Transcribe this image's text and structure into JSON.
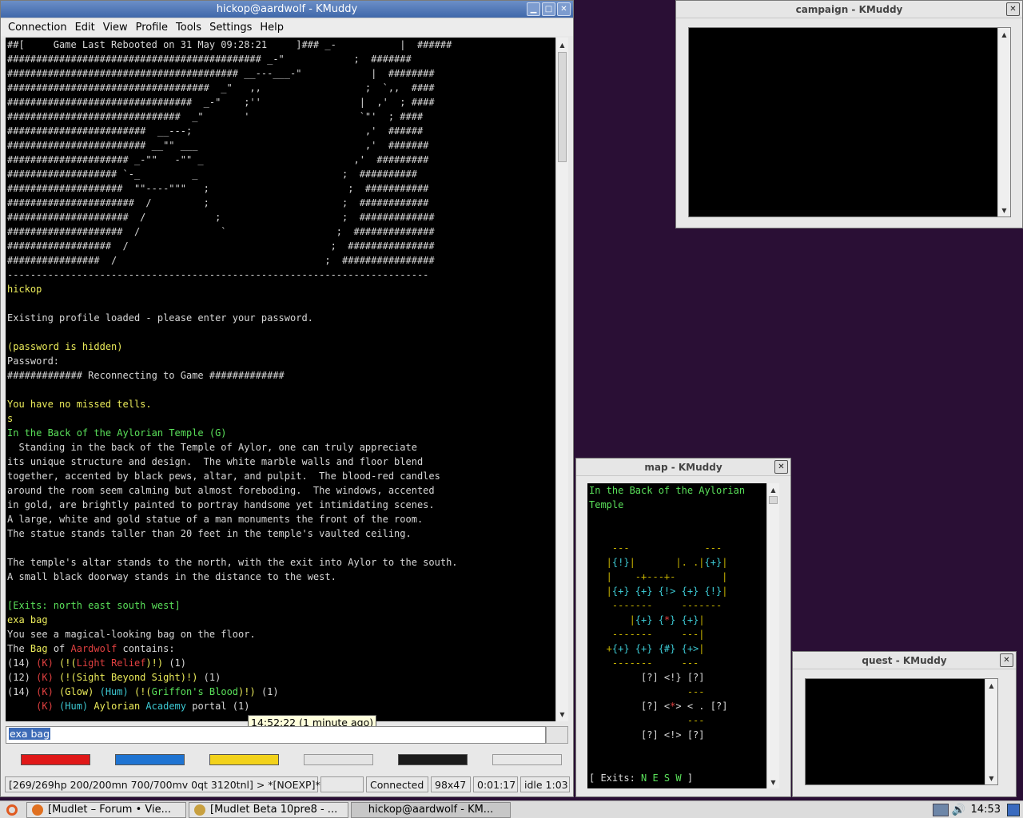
{
  "main_window": {
    "title": "hickop@aardwolf - KMuddy",
    "menu": [
      "Connection",
      "Edit",
      "View",
      "Profile",
      "Tools",
      "Settings",
      "Help"
    ],
    "terminal_lines": [
      [
        {
          "t": "##[     Game Last Rebooted on 31 May 09:28:21     ]### _-           |  ######",
          "c": "w"
        }
      ],
      [
        {
          "t": "############################################ _-\"            ;  #######",
          "c": "w"
        }
      ],
      [
        {
          "t": "######################################## __---___-\"            |  ########",
          "c": "w"
        }
      ],
      [
        {
          "t": "###################################  _\"   ,,                  ;  `,,  ####",
          "c": "w"
        }
      ],
      [
        {
          "t": "################################  _-\"    ;''                 |  ,'  ; ####",
          "c": "w"
        }
      ],
      [
        {
          "t": "##############################  _\"       '                   `\"'  ; ####",
          "c": "w"
        }
      ],
      [
        {
          "t": "########################  __---;                              ,'  ######",
          "c": "w"
        }
      ],
      [
        {
          "t": "######################## __\"\" ___                             ,'  #######",
          "c": "w"
        }
      ],
      [
        {
          "t": "##################### _-\"\"   -\"\" _                          ,'  #########",
          "c": "w"
        }
      ],
      [
        {
          "t": "################### `-_         _                         ;  ##########",
          "c": "w"
        }
      ],
      [
        {
          "t": "####################  \"\"----\"\"\"   ;                        ;  ###########",
          "c": "w"
        }
      ],
      [
        {
          "t": "######################  /         ;                       ;  ############",
          "c": "w"
        }
      ],
      [
        {
          "t": "#####################  /            ;                     ;  #############",
          "c": "w"
        }
      ],
      [
        {
          "t": "####################  /              `                   ;  ##############",
          "c": "w"
        }
      ],
      [
        {
          "t": "##################  /                                   ;  ###############",
          "c": "w"
        }
      ],
      [
        {
          "t": "################  /                                    ;  ################",
          "c": "w"
        }
      ],
      [
        {
          "t": "-------------------------------------------------------------------------",
          "c": "w"
        }
      ],
      [
        {
          "t": "hickop",
          "c": "y"
        }
      ],
      [
        {
          "t": "",
          "c": "w"
        }
      ],
      [
        {
          "t": "Existing profile loaded - please enter your password.",
          "c": "w"
        }
      ],
      [
        {
          "t": "",
          "c": "w"
        }
      ],
      [
        {
          "t": "(password is hidden)",
          "c": "y"
        }
      ],
      [
        {
          "t": "Password:",
          "c": "w"
        }
      ],
      [
        {
          "t": "############# Reconnecting to Game #############",
          "c": "w"
        }
      ],
      [
        {
          "t": "",
          "c": "w"
        }
      ],
      [
        {
          "t": "You have no missed tells.",
          "c": "y"
        }
      ],
      [
        {
          "t": "s",
          "c": "y"
        }
      ],
      [
        {
          "t": "In the Back of the Aylorian Temple (G)",
          "c": "g"
        }
      ],
      [
        {
          "t": "  Standing in the back of the Temple of Aylor, one can truly appreciate",
          "c": "w"
        }
      ],
      [
        {
          "t": "its unique structure and design.  The white marble walls and floor blend",
          "c": "w"
        }
      ],
      [
        {
          "t": "together, accented by black pews, altar, and pulpit.  The blood-red candles",
          "c": "w"
        }
      ],
      [
        {
          "t": "around the room seem calming but almost foreboding.  The windows, accented",
          "c": "w"
        }
      ],
      [
        {
          "t": "in gold, are brightly painted to portray handsome yet intimidating scenes.",
          "c": "w"
        }
      ],
      [
        {
          "t": "A large, white and gold statue of a man monuments the front of the room.",
          "c": "w"
        }
      ],
      [
        {
          "t": "The statue stands taller than 20 feet in the temple's vaulted ceiling.",
          "c": "w"
        }
      ],
      [
        {
          "t": "",
          "c": "w"
        }
      ],
      [
        {
          "t": "The temple's altar stands to the north, with the exit into Aylor to the south.",
          "c": "w"
        }
      ],
      [
        {
          "t": "A small black doorway stands in the distance to the west.",
          "c": "w"
        }
      ],
      [
        {
          "t": "",
          "c": "w"
        }
      ],
      [
        {
          "t": "[Exits: north east south west]",
          "c": "g"
        }
      ],
      [
        {
          "t": "exa bag",
          "c": "y"
        }
      ],
      [
        {
          "t": "You see a magical-looking bag on the floor.",
          "c": "w"
        }
      ],
      [
        {
          "t": "The ",
          "c": "w"
        },
        {
          "t": "Bag",
          "c": "y"
        },
        {
          "t": " of ",
          "c": "w"
        },
        {
          "t": "Aardwolf",
          "c": "r"
        },
        {
          "t": " contains:",
          "c": "w"
        }
      ],
      [
        {
          "t": "(14) ",
          "c": "w"
        },
        {
          "t": "(K) ",
          "c": "r"
        },
        {
          "t": "(!(",
          "c": "y"
        },
        {
          "t": "Light Relief",
          "c": "r"
        },
        {
          "t": ")!) ",
          "c": "y"
        },
        {
          "t": "(1)",
          "c": "w"
        }
      ],
      [
        {
          "t": "(12) ",
          "c": "w"
        },
        {
          "t": "(K) ",
          "c": "r"
        },
        {
          "t": "(!(Sight Beyond Sight)!) ",
          "c": "y"
        },
        {
          "t": "(1)",
          "c": "w"
        }
      ],
      [
        {
          "t": "(14) ",
          "c": "w"
        },
        {
          "t": "(K) ",
          "c": "r"
        },
        {
          "t": "(Glow) ",
          "c": "y"
        },
        {
          "t": "(Hum) ",
          "c": "c"
        },
        {
          "t": "(!(",
          "c": "y"
        },
        {
          "t": "Griffon's Blood",
          "c": "g"
        },
        {
          "t": ")!) ",
          "c": "y"
        },
        {
          "t": "(1)",
          "c": "w"
        }
      ],
      [
        {
          "t": "     ",
          "c": "w"
        },
        {
          "t": "(K) ",
          "c": "r"
        },
        {
          "t": "(Hum) ",
          "c": "c"
        },
        {
          "t": "Aylorian ",
          "c": "y"
        },
        {
          "t": "Academy ",
          "c": "c"
        },
        {
          "t": "portal ",
          "c": "w"
        },
        {
          "t": "(1)",
          "c": "w"
        }
      ]
    ],
    "tooltip": "14:52:22 (1 minute ago)",
    "input_value": "exa bag",
    "swatch_colors": [
      "#e01818",
      "#1f74d2",
      "#f2d21b",
      "#e4e4e4",
      "#1c1c1c",
      "#e8e8e8"
    ],
    "status": {
      "prompt": "[269/269hp 200/200mn 700/700mv 0qt 3120tnl] > *[NOEXP]*",
      "blank": "",
      "connection": "Connected",
      "size": "98x47",
      "timer": "0:01:17",
      "idle": "idle 1:03"
    }
  },
  "campaign_window": {
    "title": "campaign - KMuddy"
  },
  "map_window": {
    "title": "map - KMuddy",
    "lines": [
      [
        {
          "t": "In the Back of the Aylorian",
          "c": "g"
        }
      ],
      [
        {
          "t": "Temple",
          "c": "g"
        }
      ],
      [
        {
          "t": "",
          "c": "w"
        }
      ],
      [
        {
          "t": "",
          "c": "w"
        }
      ],
      [
        {
          "t": "    ---             ---",
          "c": "dy"
        }
      ],
      [
        {
          "t": "   |",
          "c": "dy"
        },
        {
          "t": "{!}",
          "c": "c"
        },
        {
          "t": "|       |. .|",
          "c": "dy"
        },
        {
          "t": "{+}",
          "c": "c"
        },
        {
          "t": "|",
          "c": "dy"
        }
      ],
      [
        {
          "t": "   |    -+---+-        |",
          "c": "dy"
        }
      ],
      [
        {
          "t": "   |",
          "c": "dy"
        },
        {
          "t": "{+} {+} {!> {+} {!}",
          "c": "c"
        },
        {
          "t": "|",
          "c": "dy"
        }
      ],
      [
        {
          "t": "    -------     -------",
          "c": "dy"
        }
      ],
      [
        {
          "t": "       |",
          "c": "dy"
        },
        {
          "t": "{+} ",
          "c": "c"
        },
        {
          "t": "{",
          "c": "c"
        },
        {
          "t": "*",
          "c": "r"
        },
        {
          "t": "} ",
          "c": "c"
        },
        {
          "t": "{+}",
          "c": "c"
        },
        {
          "t": "|",
          "c": "dy"
        }
      ],
      [
        {
          "t": "    -------     ---|",
          "c": "dy"
        }
      ],
      [
        {
          "t": "   +",
          "c": "dy"
        },
        {
          "t": "{+} {+} {#} {+>",
          "c": "c"
        },
        {
          "t": "|",
          "c": "dy"
        }
      ],
      [
        {
          "t": "    -------     ---",
          "c": "dy"
        }
      ],
      [
        {
          "t": "         [?] <!} [?]",
          "c": "w"
        }
      ],
      [
        {
          "t": "                 ---",
          "c": "dy"
        }
      ],
      [
        {
          "t": "         [?] <",
          "c": "w"
        },
        {
          "t": "*",
          "c": "r"
        },
        {
          "t": "> < . [?]",
          "c": "w"
        }
      ],
      [
        {
          "t": "                 ---",
          "c": "dy"
        }
      ],
      [
        {
          "t": "         [?] <!> [?]",
          "c": "w"
        }
      ],
      [
        {
          "t": "",
          "c": "w"
        }
      ],
      [
        {
          "t": "",
          "c": "w"
        }
      ],
      [
        {
          "t": "[ Exits: ",
          "c": "w"
        },
        {
          "t": "N E S W ",
          "c": "g"
        },
        {
          "t": "]",
          "c": "w"
        }
      ]
    ]
  },
  "quest_window": {
    "title": "quest - KMuddy"
  },
  "taskbar": {
    "tasks": [
      "[Mudlet – Forum • Vie...",
      "[Mudlet Beta 10pre8 - ...",
      "hickop@aardwolf - KM..."
    ],
    "clock": "14:53"
  }
}
